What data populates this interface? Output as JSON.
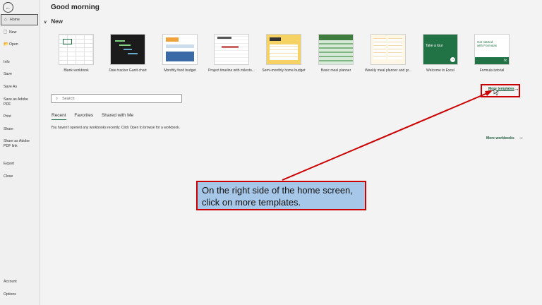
{
  "sidebar": {
    "back_icon": "back-arrow-icon",
    "items": [
      {
        "label": "Home",
        "icon": "⌂"
      },
      {
        "label": "New",
        "icon": "🗋"
      },
      {
        "label": "Open",
        "icon": "📂"
      },
      {
        "label": "Info"
      },
      {
        "label": "Save"
      },
      {
        "label": "Save As"
      },
      {
        "label": "Save as Adobe PDF"
      },
      {
        "label": "Print"
      },
      {
        "label": "Share"
      },
      {
        "label": "Share as Adobe PDF link"
      },
      {
        "label": "Export"
      },
      {
        "label": "Close"
      },
      {
        "label": "Account"
      },
      {
        "label": "Options"
      }
    ]
  },
  "main": {
    "greeting": "Good morning",
    "new_header": "New",
    "templates": [
      {
        "caption": "Blank workbook"
      },
      {
        "caption": "Date tracker Gantt chart"
      },
      {
        "caption": "Monthly food budget"
      },
      {
        "caption": "Project timeline with milesto..."
      },
      {
        "caption": "Semi-monthly home budget"
      },
      {
        "caption": "Basic meal planner"
      },
      {
        "caption": "Weekly meal planner and gr..."
      },
      {
        "caption": "Welcome to Excel",
        "thumb_text": "Take a tour"
      },
      {
        "caption": "Formula tutorial",
        "thumb_text": "Get started with Formulas"
      }
    ],
    "more_templates": "More templates",
    "search_placeholder": "Search",
    "tabs": [
      "Recent",
      "Favorites",
      "Shared with Me"
    ],
    "recent_note": "You haven't opened any workbooks recently. Click Open to browse for a workbook.",
    "more_workbooks": "More workbooks"
  },
  "callout": {
    "text": "On the right side of the home screen, click on more templates."
  },
  "colors": {
    "accent": "#217346",
    "highlight": "#cc0000",
    "callout_bg": "#a7c7e9"
  }
}
